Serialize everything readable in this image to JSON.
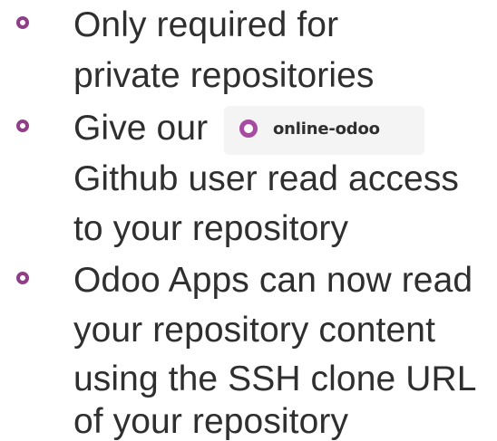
{
  "bullets": [
    {
      "lines": [
        "Only required for",
        "private repositories"
      ]
    },
    {
      "lines": [
        "Give our",
        "Github user read access",
        "to your repository"
      ],
      "user_chip": {
        "username": "online-odoo",
        "avatar_icon": "ring-avatar-icon",
        "accent": "#a64ba1"
      }
    },
    {
      "lines": [
        "Odoo Apps can now read",
        "your repository content",
        "using the SSH clone URL",
        "of your repository"
      ]
    }
  ],
  "colors": {
    "bullet_marker": "#8f3f86",
    "text": "#2f2f2f",
    "chip_background": "#f4f4f4"
  }
}
